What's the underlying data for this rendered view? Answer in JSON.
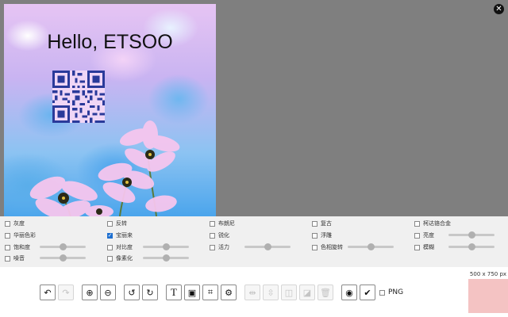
{
  "canvas": {
    "title": "Hello, ETSOO"
  },
  "close_icon": "close-icon",
  "filters": {
    "grayscale": "灰度",
    "invert": "反转",
    "brownie": "布朗尼",
    "vintage": "复古",
    "kodachrome": "柯达铬合金",
    "technicolor": "华丽色彩",
    "polaroid": "宝丽来",
    "sharpen": "锐化",
    "emboss": "浮雕",
    "brightness": "亮度",
    "saturation": "饱和度",
    "contrast": "对比度",
    "vibrance": "活力",
    "hue_rotation": "色相旋转",
    "blur": "模糊",
    "noise": "噪音",
    "pixelate": "像素化"
  },
  "filter_states": {
    "polaroid": true
  },
  "toolbar": {
    "icons": [
      "undo-icon",
      "redo-icon",
      "zoom-in-icon",
      "zoom-out-icon",
      "rotate-left-icon",
      "rotate-right-icon",
      "text-icon",
      "image-icon",
      "crop-icon",
      "settings-icon",
      "flip-horizontal-icon",
      "flip-vertical-icon",
      "bring-forward-icon",
      "send-backward-icon",
      "delete-icon",
      "preview-icon",
      "apply-icon"
    ],
    "png_label": "PNG",
    "png_checked": false
  },
  "preview": {
    "dimensions": "500 x 750 px",
    "color": "#f4c3c3"
  },
  "colors": {
    "stage": "#7f7f7f",
    "panel": "#f0f0f0",
    "checkbox_on": "#1e6fd0"
  }
}
